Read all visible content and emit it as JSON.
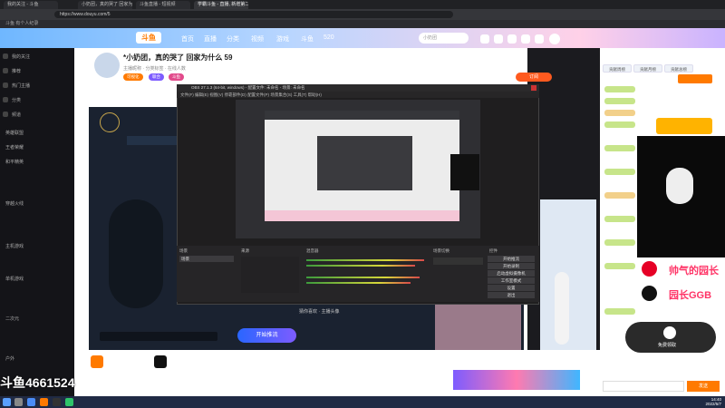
{
  "browser": {
    "tabs": [
      {
        "label": "我的关注 - 斗鱼"
      },
      {
        "label": "小奶团，真的哭了 回家为什么 - 斗鱼直播"
      },
      {
        "label": "斗鱼直播 - 短视频"
      },
      {
        "label": "学霸斗鱼 - 直播, 新增第二..."
      }
    ],
    "url": "https://www.douyu.com/5",
    "bookmarks": "斗鱼  有个人纪录"
  },
  "site": {
    "logo": "斗鱼",
    "nav": [
      "首页",
      "直播",
      "分类",
      "视频",
      "游戏",
      "斗鱼",
      "520"
    ],
    "search_placeholder": "小奶团",
    "header_icons": [
      "历史",
      "关注",
      "消息",
      "游戏",
      "鱼翅"
    ]
  },
  "sidebar": {
    "items": [
      "我的关注",
      "推荐",
      "热门主播",
      "分类",
      "频道",
      "赛事"
    ],
    "sections": [
      "英雄联盟",
      "王者荣耀",
      "和平精英",
      "穿越火线",
      "主机游戏",
      "单机游戏",
      "二次元",
      "户外"
    ]
  },
  "room": {
    "title": "*小奶团，真的哭了 回家为什么 59",
    "meta": "主播昵称 · 分类标签 · 在线人数",
    "badges": [
      "可视化",
      "联合",
      "斗鱼"
    ],
    "follow_label": "订阅",
    "stream_button": "开始推流",
    "subtitle_bar": "猜你喜欢 · 主播头像",
    "watermark": "斗鱼4661524"
  },
  "obs": {
    "title": "OBS 27.1.3 (64-bit, windows) - 配置文件: 未命名 - 场景: 未命名",
    "menu": [
      "文件(F)",
      "编辑(E)",
      "视图(V)",
      "停靠部件(D)",
      "配置文件(P)",
      "场景集合(S)",
      "工具(T)",
      "帮助(H)"
    ],
    "dock_titles": [
      "场景",
      "来源",
      "混音器",
      "场景切换",
      "控件"
    ],
    "controls": [
      "开始推流",
      "开始录制",
      "启动虚拟摄像机",
      "工作室模式",
      "设置",
      "退出"
    ],
    "scene": "场景"
  },
  "right_panel": {
    "rank_tabs": [
      "贡献周榜",
      "贡献月榜",
      "贡献总榜"
    ],
    "stickers": [
      {
        "text": "帅气的园长",
        "icon": "netease-music-icon"
      },
      {
        "text": "园长GGB",
        "icon": "tiktok-icon"
      }
    ],
    "gift_button": "免费领取",
    "send_button": "发送"
  },
  "taskbar": {
    "clock_time": "14:40",
    "clock_date": "2022/5/7"
  },
  "colors": {
    "accent": "#ff5a1f",
    "brand": "#ff7a00",
    "sticker_text": "#ff3366"
  }
}
